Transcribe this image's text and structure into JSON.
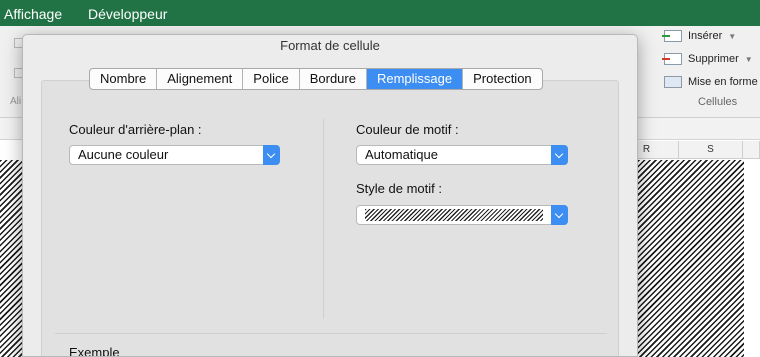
{
  "menu_tabs": [
    "Affichage",
    "Développeur"
  ],
  "ribbon": {
    "cells_group": {
      "insert_label": "Insérer",
      "delete_label": "Supprimer",
      "format_label": "Mise en forme",
      "group_label": "Cellules"
    }
  },
  "sheet": {
    "columns": [
      "R",
      "S"
    ]
  },
  "dialog": {
    "title": "Format de cellule",
    "tabs": [
      "Nombre",
      "Alignement",
      "Police",
      "Bordure",
      "Remplissage",
      "Protection"
    ],
    "active_tab": "Remplissage",
    "background_color": {
      "label": "Couleur d'arrière-plan :",
      "value": "Aucune couleur"
    },
    "pattern_color": {
      "label": "Couleur de motif :",
      "value": "Automatique"
    },
    "pattern_style": {
      "label": "Style de motif :"
    },
    "sample_label": "Exemple"
  },
  "colors": {
    "excel_green": "#217346",
    "accent_blue": "#3c8ef3"
  }
}
